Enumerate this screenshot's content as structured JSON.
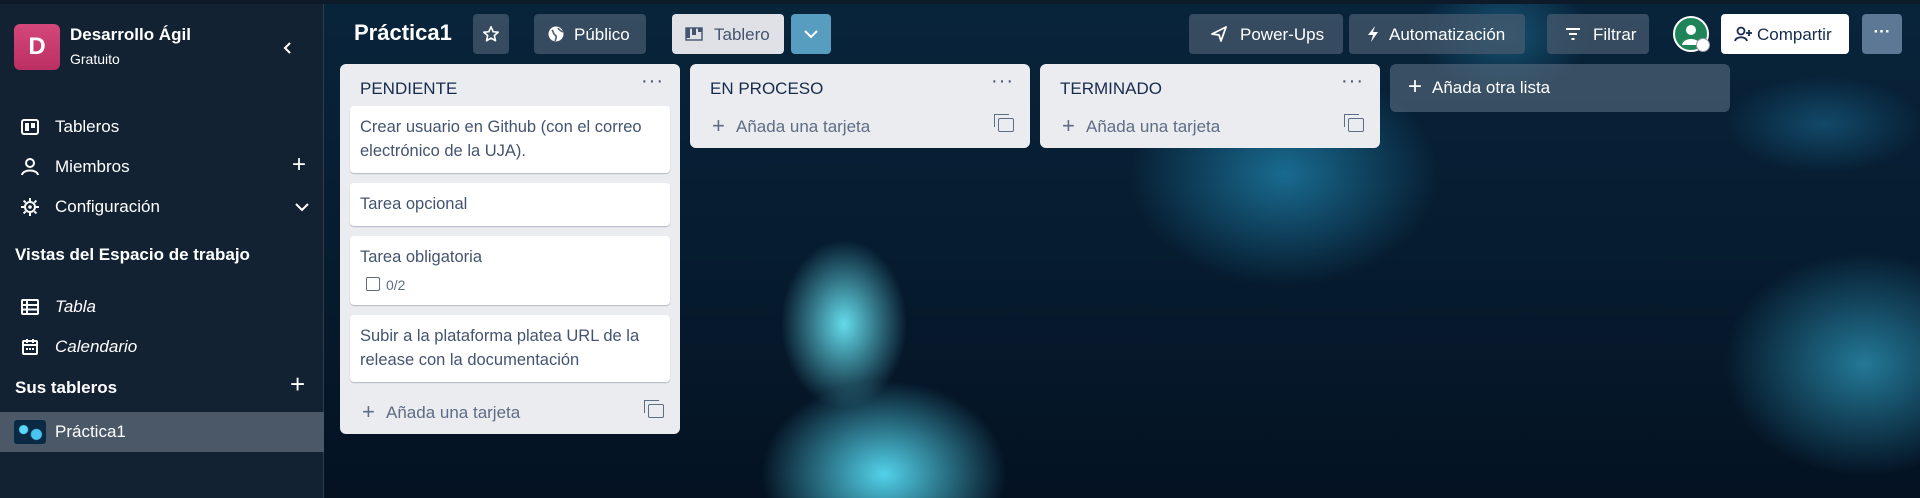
{
  "workspace": {
    "initial": "D",
    "name": "Desarrollo Ágil",
    "plan": "Gratuito",
    "collapse_icon": "chevron-left-icon"
  },
  "sidebar": {
    "items": [
      {
        "label": "Tableros",
        "icon": "board-icon"
      },
      {
        "label": "Miembros",
        "icon": "person-icon",
        "trailing": "+"
      },
      {
        "label": "Configuración",
        "icon": "gear-icon",
        "trailing": "⌄"
      }
    ],
    "views_title": "Vistas del Espacio de trabajo",
    "views": [
      {
        "label": "Tabla",
        "icon": "table-icon"
      },
      {
        "label": "Calendario",
        "icon": "calendar-icon"
      }
    ],
    "boards_title": "Sus tableros",
    "boards_add": "+",
    "boards": [
      {
        "label": "Práctica1",
        "active": true
      }
    ]
  },
  "board": {
    "title": "Práctica1",
    "visibility_label": "Público",
    "view_label": "Tablero",
    "powerups_label": "Power-Ups",
    "automation_label": "Automatización",
    "filter_label": "Filtrar",
    "share_label": "Compartir",
    "more_label": "···"
  },
  "lists": [
    {
      "title": "PENDIENTE",
      "cards": [
        {
          "text": "Crear usuario en Github (con el correo electrónico de la UJA)."
        },
        {
          "text": "Tarea opcional"
        },
        {
          "text": "Tarea obligatoria",
          "checklist": "0/2"
        },
        {
          "text": "Subir a la plataforma platea URL de la release con la documentación"
        }
      ],
      "add_label": "Añada una tarjeta"
    },
    {
      "title": "EN PROCESO",
      "cards": [],
      "add_label": "Añada una tarjeta"
    },
    {
      "title": "TERMINADO",
      "cards": [],
      "add_label": "Añada una tarjeta"
    }
  ],
  "add_list_label": "Añada otra lista",
  "list_menu_label": "···",
  "colors": {
    "sidebar_bg": "#122233",
    "list_bg": "#ebecf0",
    "workspace_avatar": "#c83c6f",
    "member_avatar": "#1f845a",
    "view_toggle": "#579dbf"
  }
}
